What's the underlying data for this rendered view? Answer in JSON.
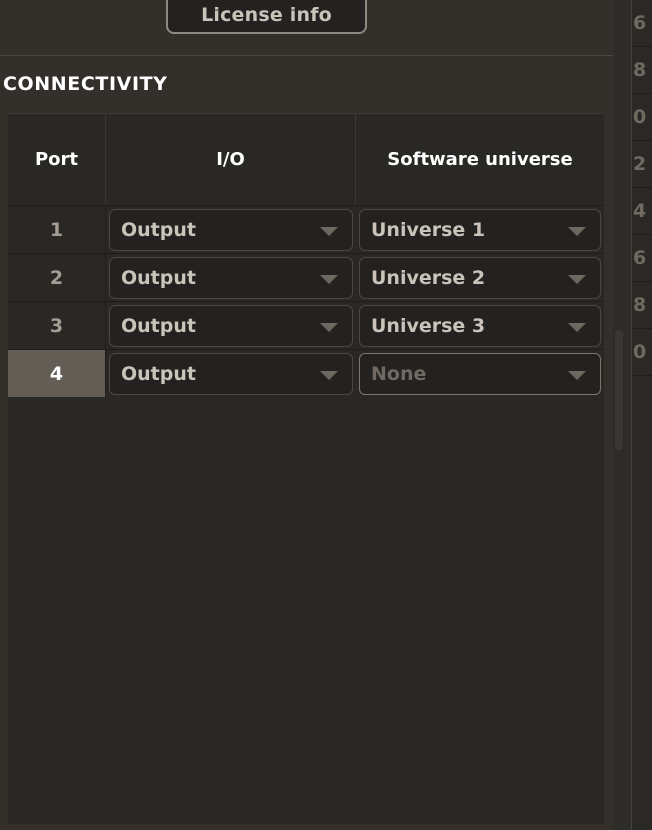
{
  "toolbar": {
    "license_button_label": "License info"
  },
  "section": {
    "title": "CONNECTIVITY"
  },
  "table": {
    "headers": {
      "port": "Port",
      "io": "I/O",
      "universe": "Software universe"
    },
    "rows": [
      {
        "port": "1",
        "io": "Output",
        "universe": "Universe 1",
        "port_selected": false,
        "universe_dim": false,
        "universe_highlight": false
      },
      {
        "port": "2",
        "io": "Output",
        "universe": "Universe 2",
        "port_selected": false,
        "universe_dim": false,
        "universe_highlight": false
      },
      {
        "port": "3",
        "io": "Output",
        "universe": "Universe 3",
        "port_selected": false,
        "universe_dim": false,
        "universe_highlight": false
      },
      {
        "port": "4",
        "io": "Output",
        "universe": "None",
        "port_selected": true,
        "universe_dim": true,
        "universe_highlight": true
      }
    ]
  },
  "right_strip": {
    "clipped_numbers": [
      "6",
      "8",
      "0",
      "2",
      "4",
      "6",
      "8",
      "0"
    ]
  },
  "colors": {
    "panel_background": "#33302c",
    "table_background": "#2a2825",
    "combo_background": "#232220",
    "selected_row": "#645d55",
    "text_primary": "#ffffff",
    "text_secondary": "#c9c3ba",
    "text_dim": "#6f6961",
    "border": "#4c4841"
  }
}
